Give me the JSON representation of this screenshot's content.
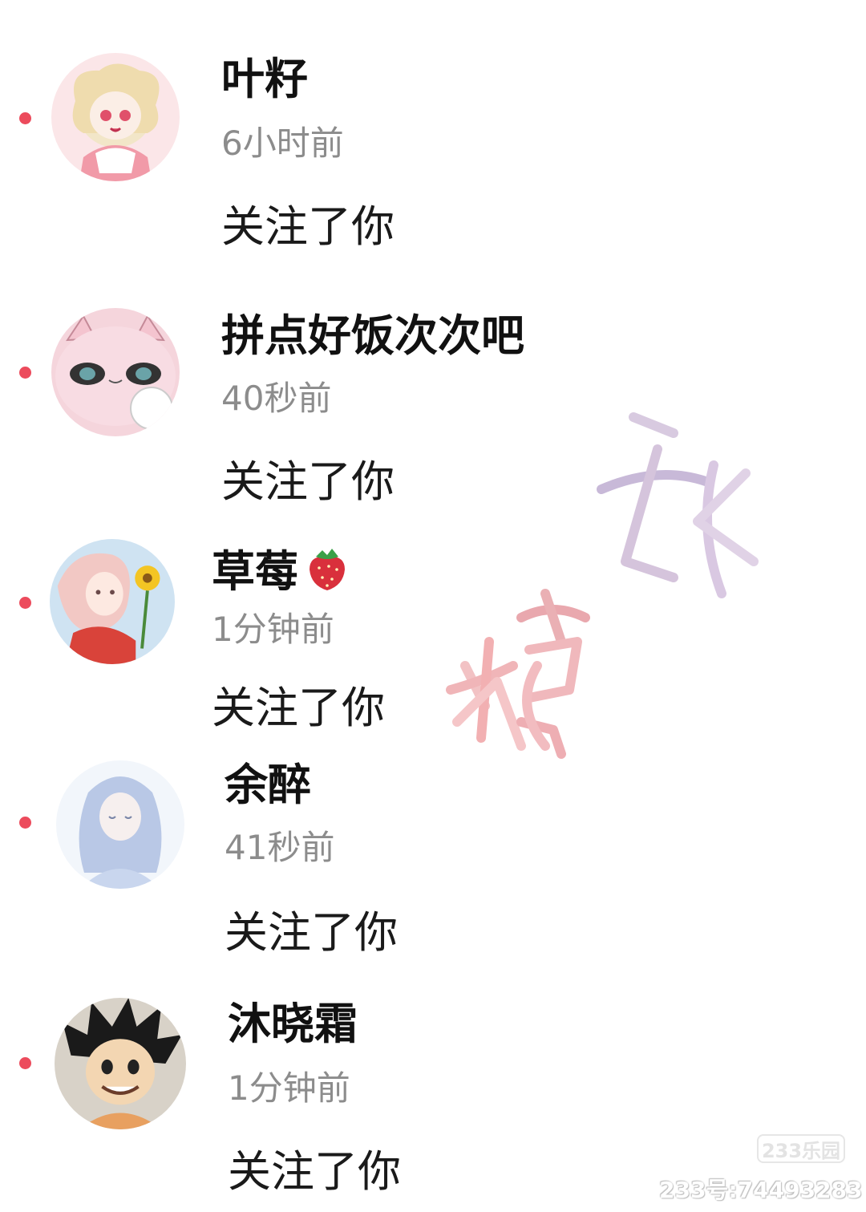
{
  "notifications": [
    {
      "username": "叶籽",
      "time": "6小时前",
      "action": "关注了你",
      "avatar_icon": "anime-girl-blonde-avatar",
      "emoji": ""
    },
    {
      "username": "拼点好饭次次吧",
      "time": "40秒前",
      "action": "关注了你",
      "avatar_icon": "pink-cartoon-cat-avatar",
      "emoji": ""
    },
    {
      "username": "草莓",
      "time": "1分钟前",
      "action": "关注了你",
      "avatar_icon": "anime-girl-sunflower-avatar",
      "emoji": "strawberry-emoji"
    },
    {
      "username": "余醉",
      "time": "41秒前",
      "action": "关注了你",
      "avatar_icon": "anime-girl-blue-hair-avatar",
      "emoji": ""
    },
    {
      "username": "沐晓霜",
      "time": "1分钟前",
      "action": "关注了你",
      "avatar_icon": "cartoon-boy-spiky-hair-avatar",
      "emoji": ""
    }
  ],
  "watermark": {
    "text": "糖球"
  },
  "branding": {
    "logo": "233乐园",
    "id": "233号:74493283"
  },
  "colors": {
    "unread_dot": "#ec4b5c",
    "username": "#111111",
    "time": "#8c8c8c"
  }
}
